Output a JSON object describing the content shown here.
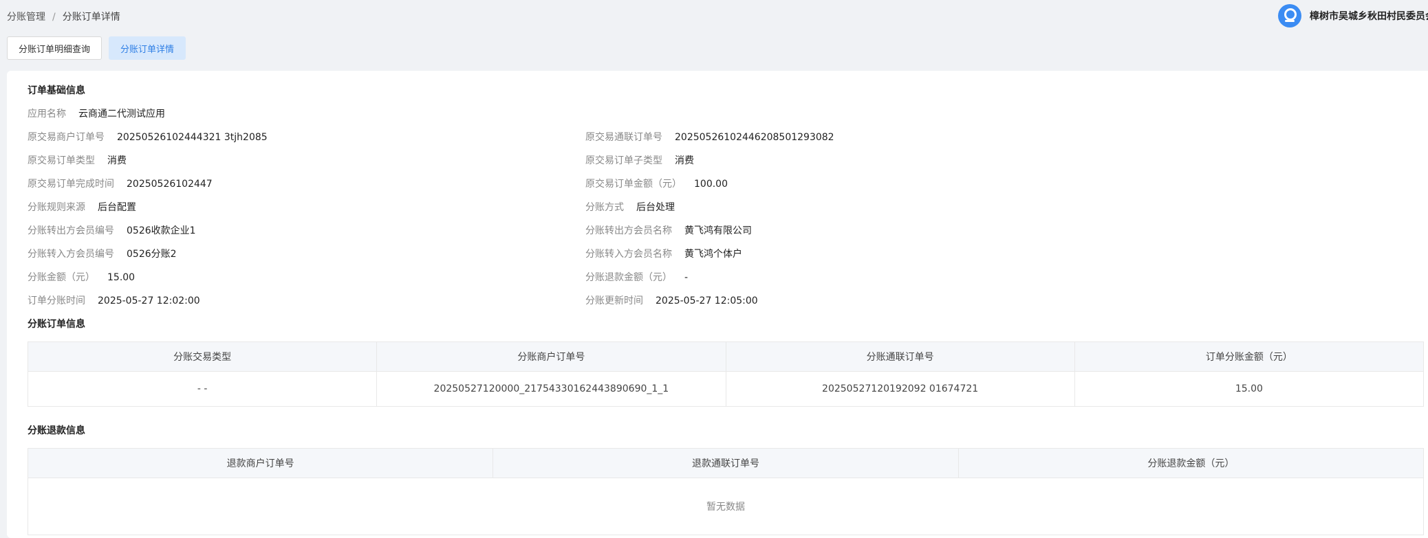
{
  "breadcrumb": {
    "root": "分账管理",
    "separator": "/",
    "current": "分账订单详情"
  },
  "user": {
    "icon": "user-avatar-icon",
    "name": "樟树市吴城乡秋田村民委员会"
  },
  "tabs": [
    {
      "label": "分账订单明细查询",
      "active": false
    },
    {
      "label": "分账订单详情",
      "active": true
    }
  ],
  "basic_info": {
    "title": "订单基础信息",
    "app": {
      "label": "应用名称",
      "value": "云商通二代测试应用"
    },
    "left": [
      {
        "label": "原交易商户订单号",
        "value": "20250526102444321 3tjh2085"
      },
      {
        "label": "原交易订单类型",
        "value": "消费"
      },
      {
        "label": "原交易订单完成时间",
        "value": "20250526102447"
      },
      {
        "label": "分账规则来源",
        "value": "后台配置"
      },
      {
        "label": "分账转出方会员编号",
        "value": "0526收款企业1"
      },
      {
        "label": "分账转入方会员编号",
        "value": "0526分账2"
      },
      {
        "label": "分账金额（元）",
        "value": "15.00"
      },
      {
        "label": "订单分账时间",
        "value": "2025-05-27 12:02:00"
      }
    ],
    "right": [
      {
        "label": "原交易通联订单号",
        "value": "20250526102446208501293082"
      },
      {
        "label": "原交易订单子类型",
        "value": "消费"
      },
      {
        "label": "原交易订单金额（元）",
        "value": "100.00"
      },
      {
        "label": "分账方式",
        "value": "后台处理"
      },
      {
        "label": "分账转出方会员名称",
        "value": "黄飞鸿有限公司"
      },
      {
        "label": "分账转入方会员名称",
        "value": "黄飞鸿个体户"
      },
      {
        "label": "分账退款金额（元）",
        "value": "-"
      },
      {
        "label": "分账更新时间",
        "value": "2025-05-27 12:05:00"
      }
    ]
  },
  "split_order": {
    "title": "分账订单信息",
    "headers": [
      "分账交易类型",
      "分账商户订单号",
      "分账通联订单号",
      "订单分账金额（元）"
    ],
    "rows": [
      [
        "- -",
        "20250527120000_21754330162443890690_1_1",
        "20250527120192092 01674721",
        "15.00"
      ]
    ]
  },
  "refund": {
    "title": "分账退款信息",
    "headers": [
      "退款商户订单号",
      "退款通联订单号",
      "分账退款金额（元）"
    ],
    "empty_text": "暂无数据"
  }
}
